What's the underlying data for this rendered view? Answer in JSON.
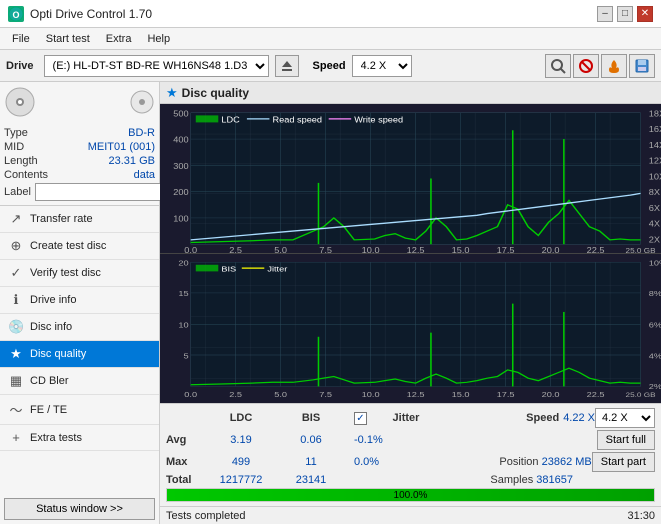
{
  "titlebar": {
    "icon": "O",
    "title": "Opti Drive Control 1.70",
    "min": "–",
    "max": "□",
    "close": "✕"
  },
  "menu": {
    "items": [
      "File",
      "Start test",
      "Extra",
      "Help"
    ]
  },
  "drive": {
    "label": "Drive",
    "select_value": "(E:)  HL-DT-ST BD-RE  WH16NS48 1.D3",
    "speed_label": "Speed",
    "speed_value": "4.2 X"
  },
  "disc": {
    "type_label": "Type",
    "type_value": "BD-R",
    "mid_label": "MID",
    "mid_value": "MEIT01 (001)",
    "length_label": "Length",
    "length_value": "23.31 GB",
    "contents_label": "Contents",
    "contents_value": "data",
    "label_label": "Label"
  },
  "nav": {
    "items": [
      {
        "id": "transfer-rate",
        "label": "Transfer rate",
        "icon": "↗"
      },
      {
        "id": "create-test-disc",
        "label": "Create test disc",
        "icon": "⊕"
      },
      {
        "id": "verify-test-disc",
        "label": "Verify test disc",
        "icon": "✓"
      },
      {
        "id": "drive-info",
        "label": "Drive info",
        "icon": "ℹ"
      },
      {
        "id": "disc-info",
        "label": "Disc info",
        "icon": "💿"
      },
      {
        "id": "disc-quality",
        "label": "Disc quality",
        "icon": "★",
        "active": true
      },
      {
        "id": "cd-bler",
        "label": "CD Bler",
        "icon": "▦"
      },
      {
        "id": "fe-te",
        "label": "FE / TE",
        "icon": "~"
      },
      {
        "id": "extra-tests",
        "label": "Extra tests",
        "icon": "+"
      }
    ]
  },
  "disc_quality": {
    "title": "Disc quality",
    "chart1": {
      "legend": [
        "LDC",
        "Read speed",
        "Write speed"
      ],
      "y_left_max": 500,
      "y_left_labels": [
        "500",
        "400",
        "300",
        "200",
        "100"
      ],
      "y_right_labels": [
        "18X",
        "16X",
        "14X",
        "12X",
        "10X",
        "8X",
        "6X",
        "4X",
        "2X"
      ],
      "x_labels": [
        "0.0",
        "2.5",
        "5.0",
        "7.5",
        "10.0",
        "12.5",
        "15.0",
        "17.5",
        "20.0",
        "22.5",
        "25.0 GB"
      ]
    },
    "chart2": {
      "legend": [
        "BIS",
        "Jitter"
      ],
      "y_left_max": 20,
      "y_left_labels": [
        "20",
        "15",
        "10",
        "5"
      ],
      "y_right_labels": [
        "10%",
        "8%",
        "6%",
        "4%",
        "2%"
      ],
      "x_labels": [
        "0.0",
        "2.5",
        "5.0",
        "7.5",
        "10.0",
        "12.5",
        "15.0",
        "17.5",
        "20.0",
        "22.5",
        "25.0 GB"
      ]
    }
  },
  "stats": {
    "headers": [
      "LDC",
      "BIS",
      "",
      "Jitter",
      "Speed",
      ""
    ],
    "avg_label": "Avg",
    "avg_ldc": "3.19",
    "avg_bis": "0.06",
    "avg_jitter": "-0.1%",
    "avg_speed": "4.22 X",
    "max_label": "Max",
    "max_ldc": "499",
    "max_bis": "11",
    "max_jitter": "0.0%",
    "max_position": "23862 MB",
    "total_label": "Total",
    "total_ldc": "1217772",
    "total_bis": "23141",
    "total_samples": "381657",
    "position_label": "Position",
    "samples_label": "Samples",
    "speed_dropdown": "4.2 X",
    "start_full": "Start full",
    "start_part": "Start part",
    "jitter_label": "Jitter"
  },
  "progress": {
    "percent": "100.0%",
    "fill_width": "100%"
  },
  "status": {
    "text": "Tests completed",
    "time": "31:30"
  }
}
